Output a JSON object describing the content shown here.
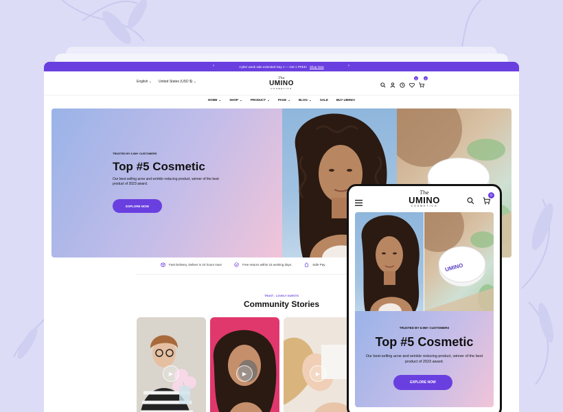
{
  "announcement": {
    "text": "Cyber week sale extended Day 1 — Get 1 FREE!",
    "link": "Shop Now",
    "prev_icon": "chevron-left-icon",
    "next_icon": "chevron-right-icon"
  },
  "header": {
    "language": "English",
    "currency": "United States (USD $)",
    "logo": {
      "prefix": "The",
      "name": "UMINO",
      "tagline": "COSMETICS"
    },
    "wishlist_count": "0",
    "cart_count": "0"
  },
  "nav": {
    "items": [
      {
        "label": "HOME",
        "dropdown": true
      },
      {
        "label": "SHOP",
        "dropdown": true
      },
      {
        "label": "PRODUCT",
        "dropdown": true
      },
      {
        "label": "PAGE",
        "dropdown": true
      },
      {
        "label": "BLOG",
        "dropdown": true
      },
      {
        "label": "SALE",
        "dropdown": false
      },
      {
        "label": "BUY UMINO!",
        "dropdown": false
      }
    ]
  },
  "hero": {
    "eyebrow": "TRUSTED BY 6.9M+ CUSTOMERS",
    "title": "Top #5 Cosmetic",
    "description": "Our best-selling acne and wrinkle reducing product, winner of the best product of 2023 award.",
    "cta": "EXPLORE NOW"
  },
  "features": [
    {
      "icon": "delivery-box-icon",
      "text": "Fast Delivery, Deliver in 24 hours max!"
    },
    {
      "icon": "returns-icon",
      "text": "Free returns within 15 working days."
    },
    {
      "icon": "safe-payment-icon",
      "text": "Safe Pay"
    }
  ],
  "community": {
    "eyebrow": "TRUST - LOVELY GUESTS",
    "title": "Community Stories"
  },
  "mobile": {
    "logo": {
      "prefix": "The",
      "name": "UMINO",
      "tagline": "COSMETICS"
    },
    "cart_count": "0",
    "product_label": "UMINO",
    "hero": {
      "eyebrow": "TRUSTED BY 6.9M+ CUSTOMERS",
      "title": "Top #5 Cosmetic",
      "description": "Our best-selling acne and wrinkle reducing product, winner of the best product of 2023 award.",
      "cta": "EXPLORE NOW"
    }
  },
  "colors": {
    "accent": "#6a3fe0",
    "background": "#dcdcf6"
  }
}
